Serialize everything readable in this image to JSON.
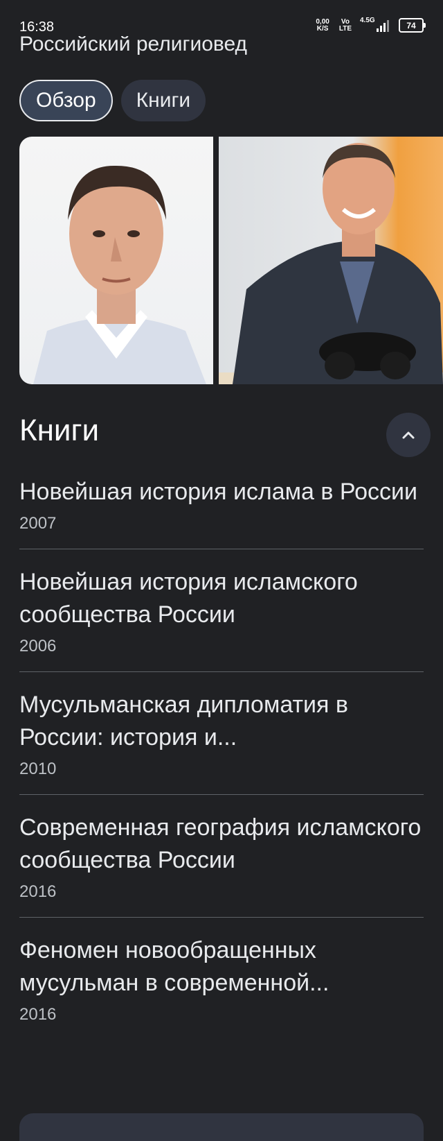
{
  "status": {
    "time": "16:38",
    "net_speed_value": "0,00",
    "net_speed_unit": "K/S",
    "volte_top": "Vo",
    "volte_bottom": "LTE",
    "network": "4.5G",
    "battery": "74"
  },
  "header": {
    "subtitle": "Российский религиовед"
  },
  "tabs": [
    {
      "label": "Обзор",
      "active": true
    },
    {
      "label": "Книги",
      "active": false
    }
  ],
  "section": {
    "title": "Книги"
  },
  "books": [
    {
      "title": "Новейшая история ислама в России",
      "year": "2007"
    },
    {
      "title": "Новейшая история исламского сообщества России",
      "year": "2006"
    },
    {
      "title": "Мусульманская дипломатия в России: история и...",
      "year": "2010"
    },
    {
      "title": "Современная география исламского сообщества России",
      "year": "2016"
    },
    {
      "title": "Феномен новообращенных мусульман в современной...",
      "year": "2016"
    }
  ],
  "icons": {
    "collapse": "chevron-up-icon"
  },
  "colors": {
    "background": "#202124",
    "chip_active": "#394457",
    "chip_inactive": "#303440",
    "divider": "#5f6368"
  }
}
